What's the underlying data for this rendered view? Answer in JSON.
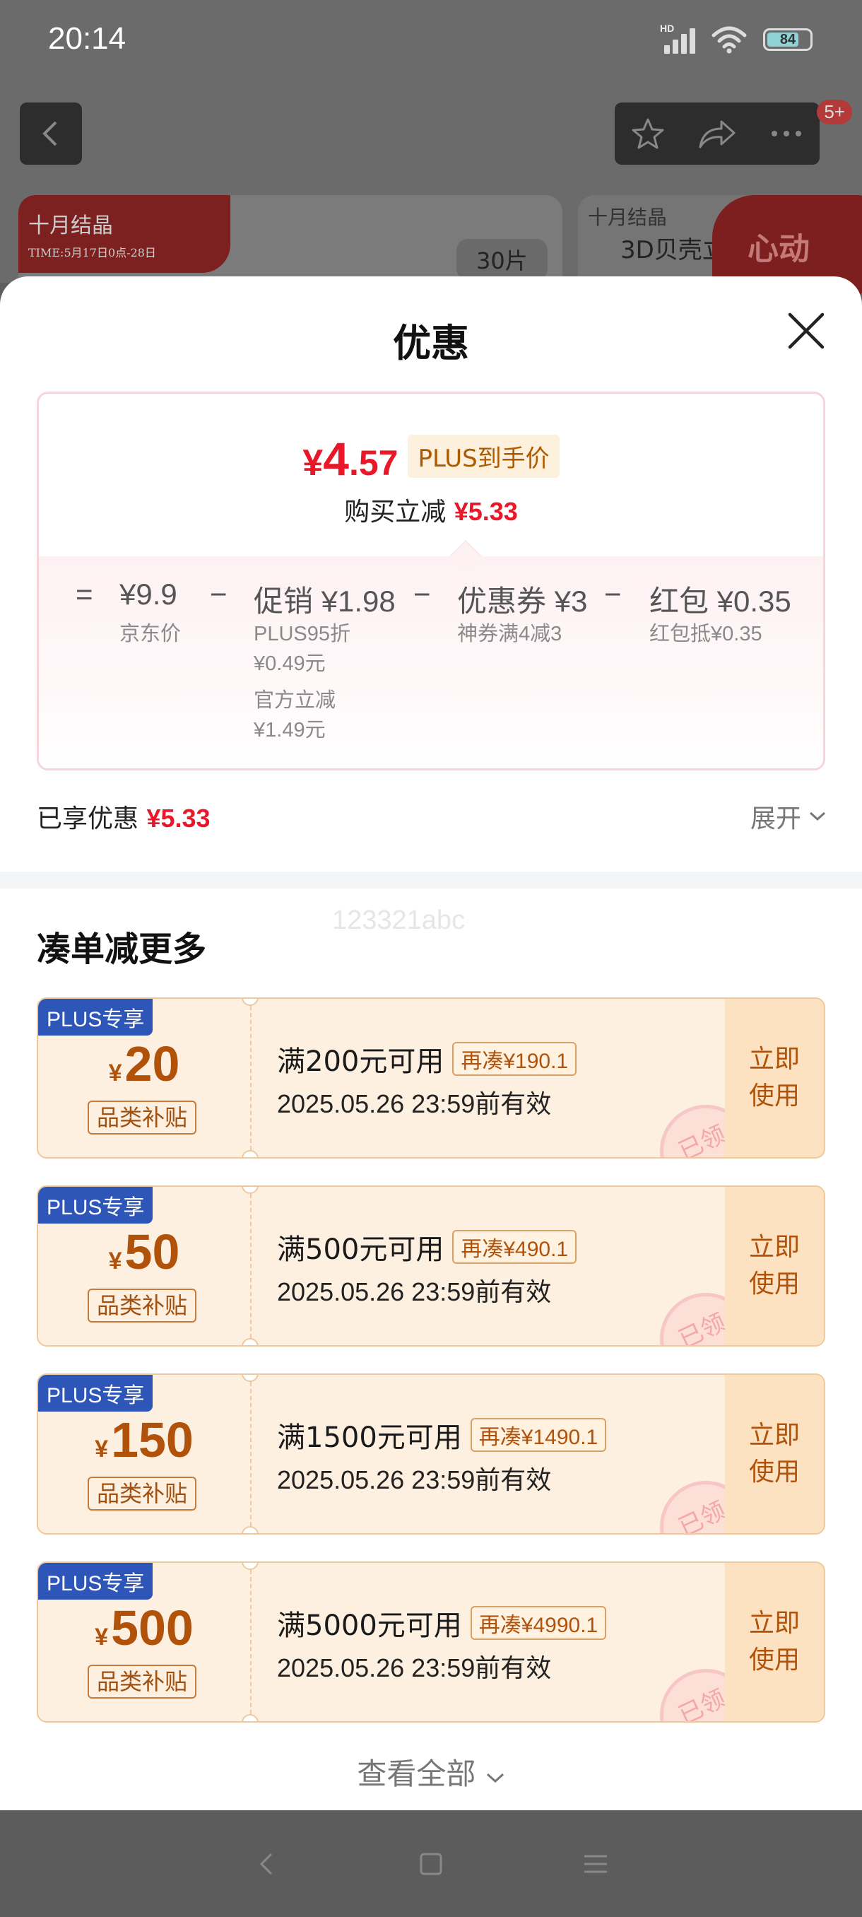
{
  "status_bar": {
    "time": "20:14",
    "hd": "HD",
    "battery": "84"
  },
  "top_nav": {
    "badge": "5+"
  },
  "background": {
    "banner_left_brand": "十月结晶",
    "banner_left_sub": "TIME:5月17日0点-28日",
    "banner_left_pill": "30片",
    "banner_right_brand": "十月结晶",
    "banner_right_text": "3D贝壳立",
    "banner_right_promo": "心动"
  },
  "sheet": {
    "title": "优惠"
  },
  "price_card": {
    "price_yen": "¥",
    "price_int": "4",
    "price_dec": ".57",
    "plus_tag": "PLUS到手价",
    "instant_label": "购买立减",
    "instant_value": "¥5.33",
    "breakdown": [
      {
        "op": "=",
        "main": "¥9.9",
        "subs": [
          "京东价"
        ]
      },
      {
        "op": "−",
        "main": "促销 ¥1.98",
        "subs": [
          "PLUS95折",
          "¥0.49元",
          "官方立减",
          "¥1.49元"
        ]
      },
      {
        "op": "−",
        "main": "优惠券 ¥3",
        "subs": [
          "神券满4减3"
        ]
      },
      {
        "op": "−",
        "main": "红包 ¥0.35",
        "subs": [
          "红包抵¥0.35"
        ]
      }
    ]
  },
  "enjoyed": {
    "label": "已享优惠",
    "value": "¥5.33",
    "expand": "展开"
  },
  "watermark": "123321abc",
  "section_title": "凑单减更多",
  "coupons": [
    {
      "tag": "PLUS专享",
      "yen": "¥",
      "amount": "20",
      "category": "品类补贴",
      "condition": "满200元可用",
      "more": "再凑¥190.1",
      "valid": "2025.05.26 23:59前有效",
      "use": "立即使用",
      "stamp": "已领"
    },
    {
      "tag": "PLUS专享",
      "yen": "¥",
      "amount": "50",
      "category": "品类补贴",
      "condition": "满500元可用",
      "more": "再凑¥490.1",
      "valid": "2025.05.26 23:59前有效",
      "use": "立即使用",
      "stamp": "已领"
    },
    {
      "tag": "PLUS专享",
      "yen": "¥",
      "amount": "150",
      "category": "品类补贴",
      "condition": "满1500元可用",
      "more": "再凑¥1490.1",
      "valid": "2025.05.26 23:59前有效",
      "use": "立即使用",
      "stamp": "已领"
    },
    {
      "tag": "PLUS专享",
      "yen": "¥",
      "amount": "500",
      "category": "品类补贴",
      "condition": "满5000元可用",
      "more": "再凑¥4990.1",
      "valid": "2025.05.26 23:59前有效",
      "use": "立即使用",
      "stamp": "已领"
    }
  ],
  "view_all": "查看全部",
  "icons": {
    "back": "chevron-left-icon",
    "favorite": "star-icon",
    "share": "share-icon",
    "more": "more-icon",
    "close": "close-icon",
    "expand": "chevron-down-icon"
  },
  "colors": {
    "accent_red": "#e8182a",
    "coupon_brown": "#b0520a",
    "plus_blue": "#2e55b8"
  }
}
